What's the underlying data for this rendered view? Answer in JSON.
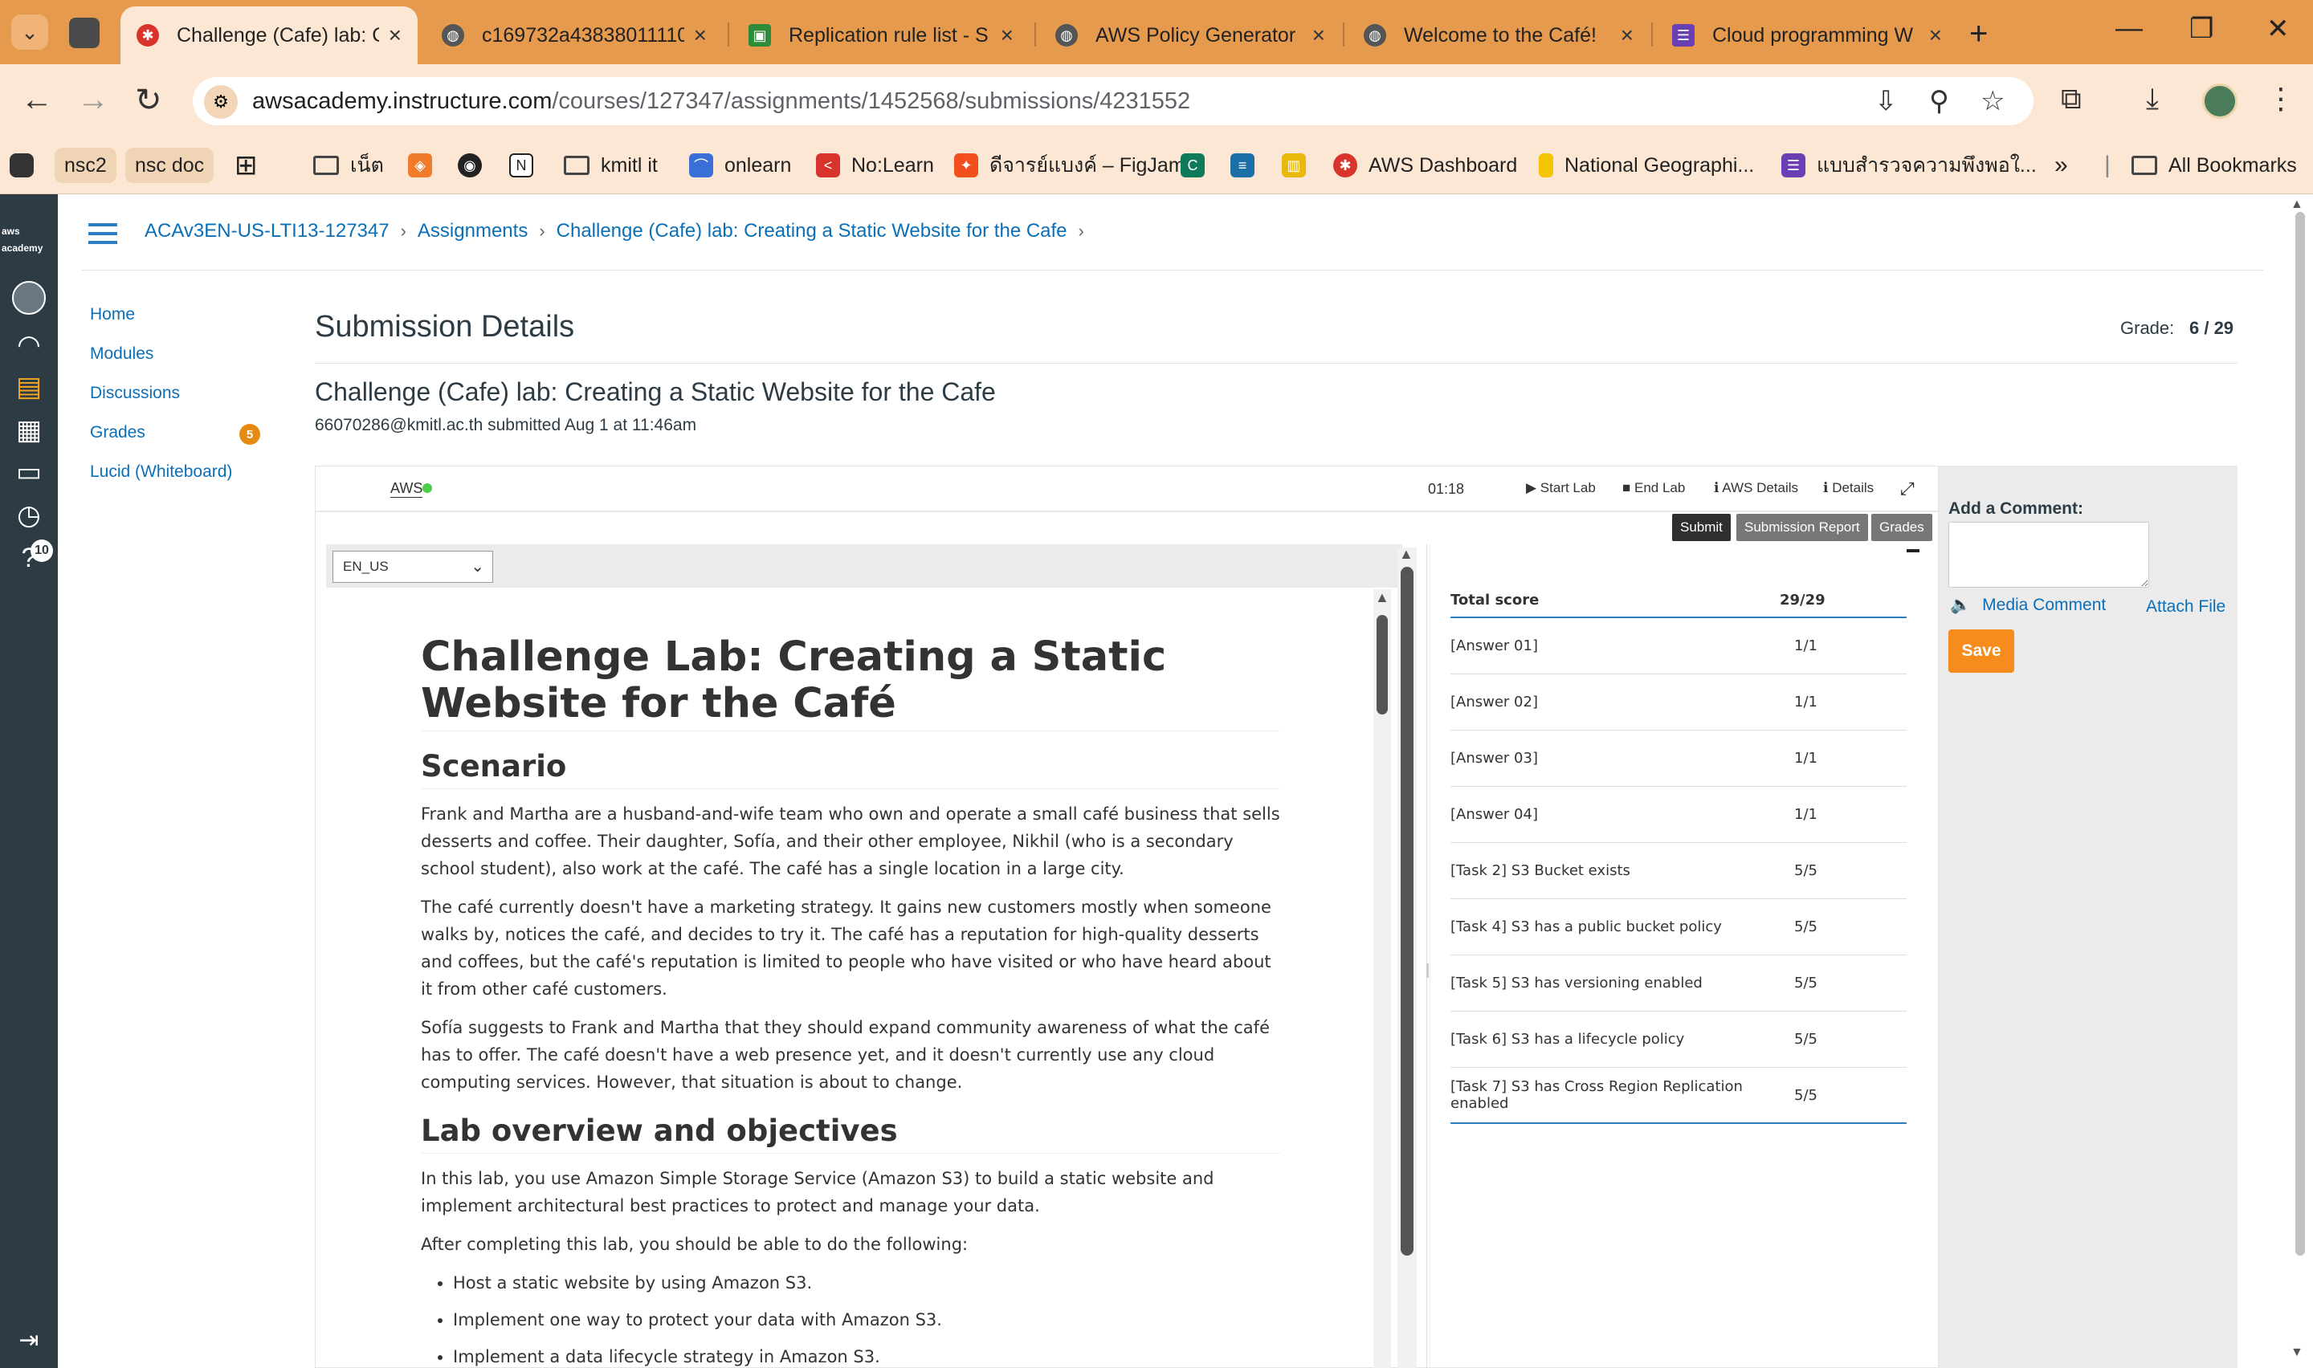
{
  "browser": {
    "tabs": [
      {
        "title": "Challenge (Cafe) lab: C",
        "active": true,
        "favicon": "canvas-icon"
      },
      {
        "title": "c169732a43838011110",
        "active": false,
        "favicon": "globe-icon"
      },
      {
        "title": "Replication rule list - S",
        "active": false,
        "favicon": "aws-icon"
      },
      {
        "title": "AWS Policy Generator",
        "active": false,
        "favicon": "globe-icon"
      },
      {
        "title": "Welcome to the Café!",
        "active": false,
        "favicon": "globe-icon"
      },
      {
        "title": "Cloud programming W",
        "active": false,
        "favicon": "forms-icon"
      }
    ],
    "url_host": "awsacademy.instructure.com",
    "url_path": "/courses/127347/assignments/1452568/submissions/4231552",
    "bookmarks": [
      "nsc2",
      "nsc doc",
      "เน็ต",
      "kmitl it",
      "onlearn",
      "No:Learn",
      "ดีจารย์แบงค์ – FigJam",
      "AWS Dashboard",
      "National Geographi...",
      "แบบสำรวจความพึงพอใ...",
      "All Bookmarks"
    ],
    "colors": {
      "tabstrip": "#e59a4e",
      "toolbar": "#fbe7d3"
    }
  },
  "global_nav": {
    "logo": "aws academy",
    "help_badge": "10"
  },
  "breadcrumb": [
    "ACAv3EN-US-LTI13-127347",
    "Assignments",
    "Challenge (Cafe) lab: Creating a Static Website for the Cafe"
  ],
  "course_nav": {
    "items": [
      "Home",
      "Modules",
      "Discussions",
      "Grades",
      "Lucid (Whiteboard)"
    ],
    "grades_badge": "5"
  },
  "submission": {
    "heading": "Submission Details",
    "grade_label": "Grade:",
    "grade_value": "6 / 29",
    "assignment_title": "Challenge (Cafe) lab: Creating a Static Website for the Cafe",
    "submitter": "66070286@kmitl.ac.th",
    "submitted_text": "submitted Aug 1 at 11:46am"
  },
  "lab": {
    "aws_label": "AWS",
    "timer": "01:18",
    "links": [
      "Start Lab",
      "End Lab",
      "AWS Details",
      "Details"
    ],
    "buttons": [
      "Submit",
      "Submission Report",
      "Grades"
    ],
    "language": "EN_US",
    "doc": {
      "h1": "Challenge Lab: Creating a Static Website for the Café",
      "scenario_h": "Scenario",
      "p1": "Frank and Martha are a husband-and-wife team who own and operate a small café business that sells desserts and coffee. Their daughter, Sofía, and their other employee, Nikhil (who is a secondary school student), also work at the café. The café has a single location in a large city.",
      "p2": "The café currently doesn't have a marketing strategy. It gains new customers mostly when someone walks by, notices the café, and decides to try it. The café has a reputation for high-quality desserts and coffees, but the café's reputation is limited to people who have visited or who have heard about it from other café customers.",
      "p3": "Sofía suggests to Frank and Martha that they should expand community awareness of what the café has to offer. The café doesn't have a web presence yet, and it doesn't currently use any cloud computing services. However, that situation is about to change.",
      "overview_h": "Lab overview and objectives",
      "p4": "In this lab, you use Amazon Simple Storage Service (Amazon S3) to build a static website and implement architectural best practices to protect and manage your data.",
      "p5": "After completing this lab, you should be able to do the following:",
      "bullets": [
        "Host a static website by using Amazon S3.",
        "Implement one way to protect your data with Amazon S3.",
        "Implement a data lifecycle strategy in Amazon S3."
      ]
    },
    "score": {
      "total_label": "Total score",
      "total_value": "29/29",
      "rows": [
        {
          "name": "[Answer 01]",
          "value": "1/1"
        },
        {
          "name": "[Answer 02]",
          "value": "1/1"
        },
        {
          "name": "[Answer 03]",
          "value": "1/1"
        },
        {
          "name": "[Answer 04]",
          "value": "1/1"
        },
        {
          "name": "[Task 2] S3 Bucket exists",
          "value": "5/5"
        },
        {
          "name": "[Task 4] S3 has a public bucket policy",
          "value": "5/5"
        },
        {
          "name": "[Task 5] S3 has versioning enabled",
          "value": "5/5"
        },
        {
          "name": "[Task 6] S3 has a lifecycle policy",
          "value": "5/5"
        },
        {
          "name": "[Task 7] S3 has Cross Region Replication enabled",
          "value": "5/5"
        }
      ]
    }
  },
  "comment": {
    "label": "Add a Comment:",
    "media": "Media Comment",
    "attach": "Attach File",
    "save": "Save"
  }
}
